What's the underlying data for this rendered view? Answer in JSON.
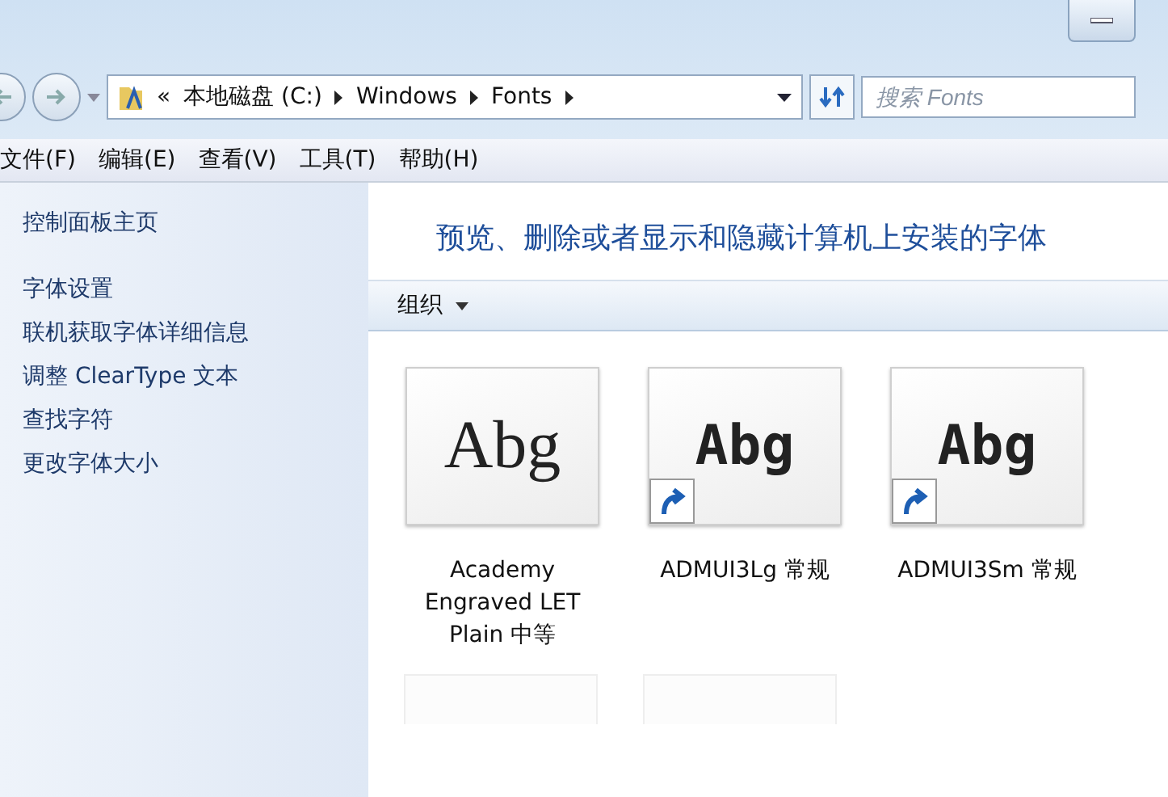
{
  "address_bar": {
    "overflow": "«",
    "crumbs": [
      "本地磁盘 (C:)",
      "Windows",
      "Fonts"
    ]
  },
  "search": {
    "placeholder": "搜索 Fonts"
  },
  "menu": [
    "文件(F)",
    "编辑(E)",
    "查看(V)",
    "工具(T)",
    "帮助(H)"
  ],
  "sidebar": {
    "home": "控制面板主页",
    "links": [
      "字体设置",
      "联机获取字体详细信息",
      "调整 ClearType 文本",
      "查找字符",
      "更改字体大小"
    ]
  },
  "heading": "预览、删除或者显示和隐藏计算机上安装的字体",
  "toolbar": {
    "organize": "组织"
  },
  "fonts": [
    {
      "name": "Academy Engraved LET Plain 中等",
      "preview": "Abg",
      "kind": "serif",
      "shortcut": false
    },
    {
      "name": "ADMUI3Lg 常规",
      "preview": "Abg",
      "kind": "pixel",
      "shortcut": true
    },
    {
      "name": "ADMUI3Sm 常规",
      "preview": "Abg",
      "kind": "pixel",
      "shortcut": true
    }
  ]
}
